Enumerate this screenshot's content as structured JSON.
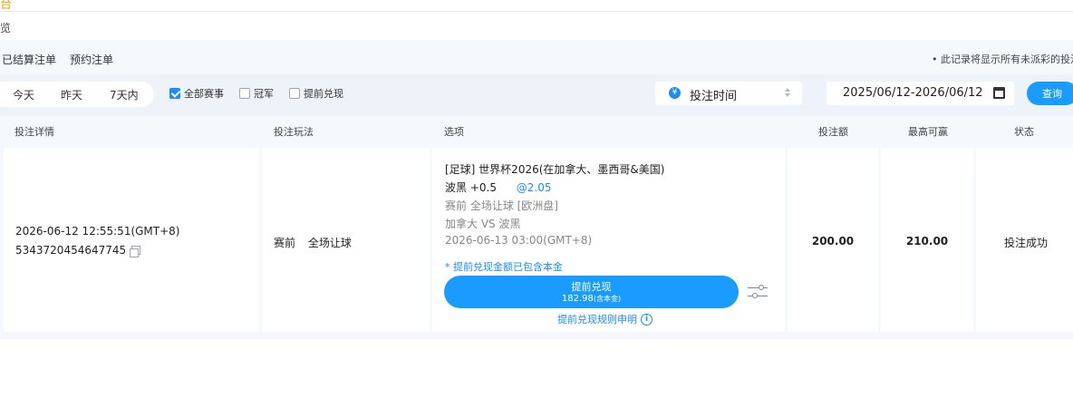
{
  "header": {
    "top_glyph": "台",
    "sub_label": "览"
  },
  "tabs": [
    {
      "label": "已结算注单"
    },
    {
      "label": "预约注单"
    }
  ],
  "notice": "• 此记录将显示所有未派彩的投注",
  "filters": {
    "days": [
      "今天",
      "昨天",
      "7天内"
    ],
    "checkboxes": [
      {
        "label": "全部赛事",
        "checked": true
      },
      {
        "label": "冠军",
        "checked": false
      },
      {
        "label": "提前兑现",
        "checked": false
      }
    ],
    "sort_select": {
      "icon": "¥",
      "value": "投注时间"
    },
    "date_range": "2025/06/12-2026/06/12",
    "query_label": "查询"
  },
  "table": {
    "headers": [
      "投注详情",
      "投注玩法",
      "选项",
      "投注额",
      "最高可赢",
      "状态"
    ],
    "row": {
      "bet_time": "2026-06-12 12:55:51(GMT+8)",
      "bet_id": "5343720454647745",
      "play_type": [
        "赛前",
        "全场让球"
      ],
      "league": "[足球] 世界杯2026(在加拿大、墨西哥&美国)",
      "pick": "波黑 +0.5",
      "odds": "@2.05",
      "market": "赛前 全场让球 [欧洲盘]",
      "match": "加拿大 VS 波黑",
      "match_time": "2026-06-13 03:00(GMT+8)",
      "cashout_note": "* 提前兑现金额已包含本金",
      "cashout_label": "提前兑现",
      "cashout_amount": "182.98",
      "cashout_suffix": "(含本金)",
      "rules_link": "提前兑现规则申明",
      "stake": "200.00",
      "max_win": "210.00",
      "status": "投注成功"
    }
  },
  "colors": {
    "accent": "#1a9bff",
    "panel_bg": "#f5f8fc",
    "filter_bg": "#eef3fa"
  }
}
